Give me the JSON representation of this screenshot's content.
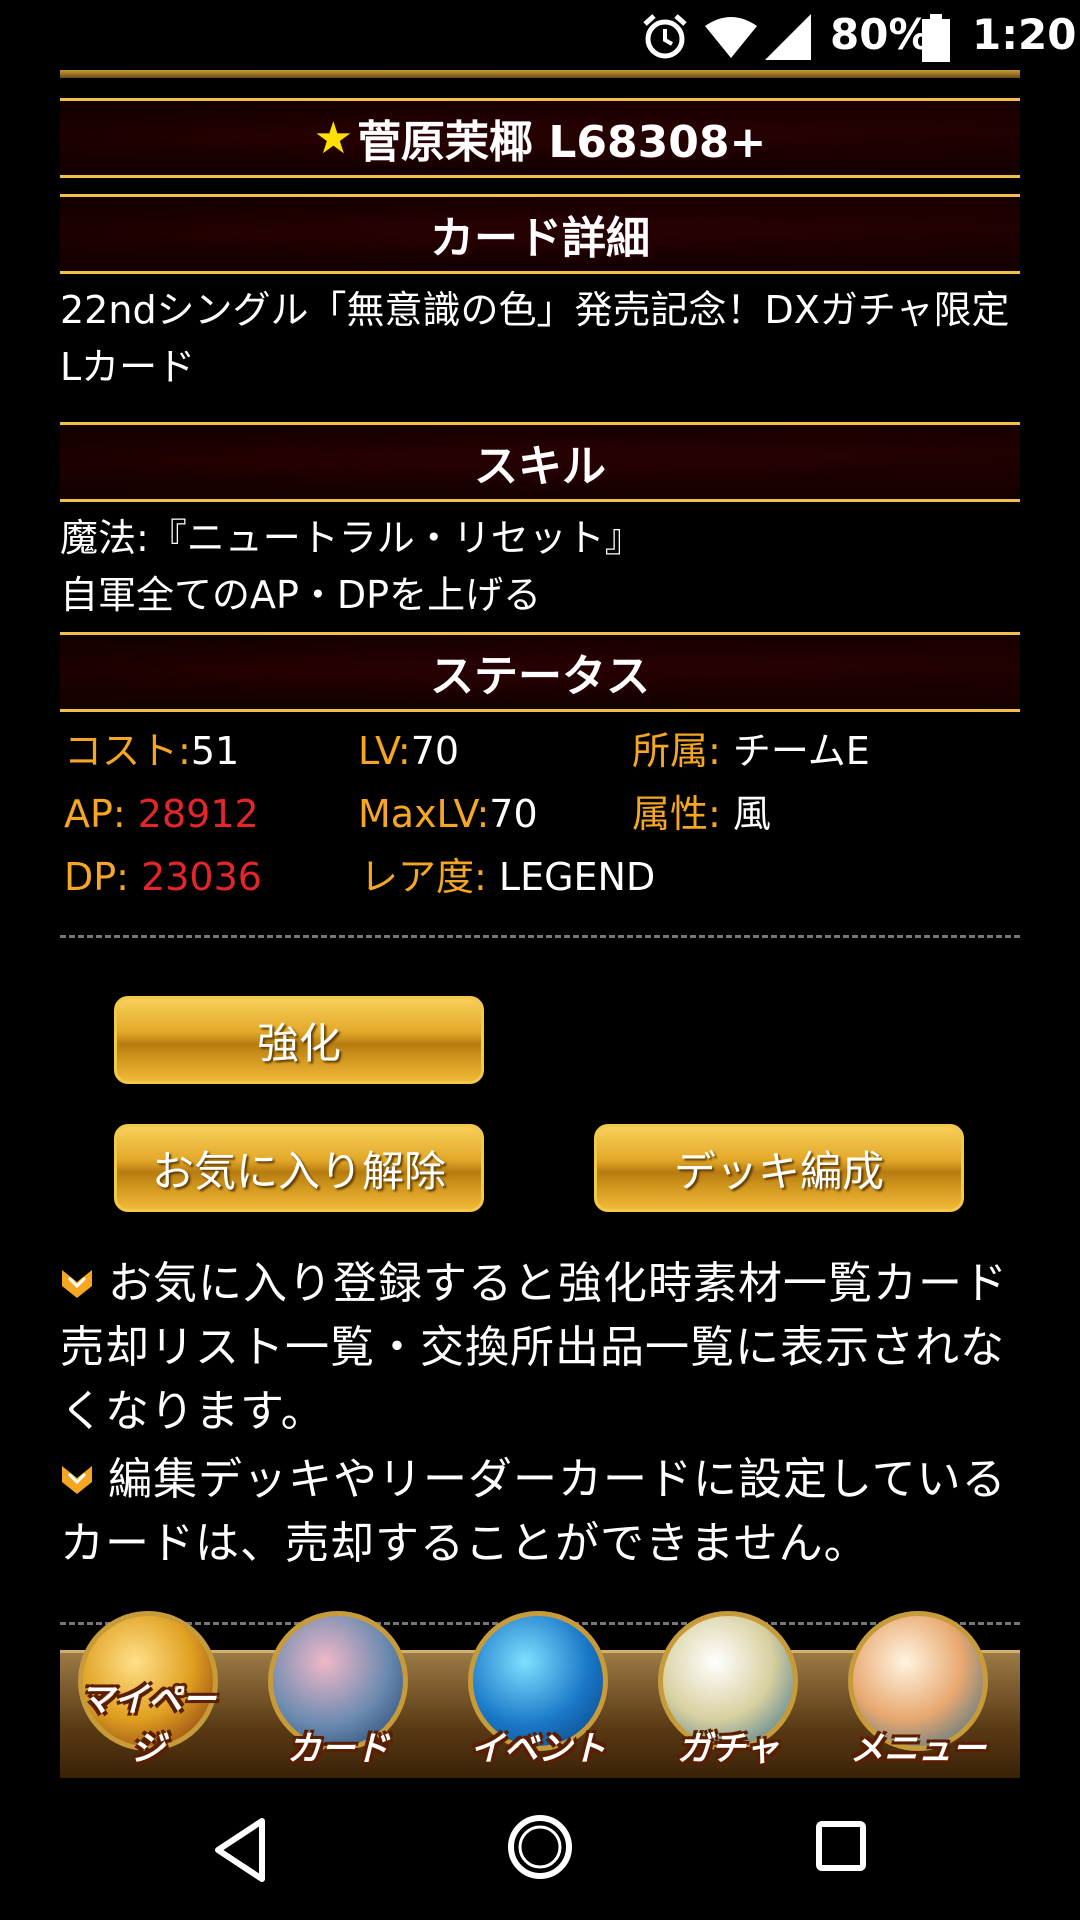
{
  "status_bar": {
    "battery_percent": "80%",
    "time": "1:20",
    "icons": [
      "alarm-icon",
      "wifi-icon",
      "signal-icon",
      "battery-icon"
    ]
  },
  "card": {
    "title_star": "★",
    "title": "菅原茉椰 L68308+"
  },
  "sections": {
    "detail_header": "カード詳細",
    "detail_text": "22ndシングル「無意識の色」発売記念！DXガチャ限定Lカード",
    "skill_header": "スキル",
    "skill_line1": "魔法:『ニュートラル・リセット』",
    "skill_line2": "自軍全てのAP・DPを上げる",
    "status_header": "ステータス"
  },
  "stats": {
    "cost_label": "コスト:",
    "cost_value": "51",
    "lv_label": "LV:",
    "lv_value": "70",
    "affiliation_label": "所属:",
    "affiliation_value": " チームE",
    "ap_label": "AP:",
    "ap_value": " 28912",
    "maxlv_label": "MaxLV:",
    "maxlv_value": "70",
    "attribute_label": "属性:",
    "attribute_value": " 風",
    "dp_label": "DP:",
    "dp_value": " 23036",
    "rarity_label": "レア度:",
    "rarity_value": " LEGEND"
  },
  "buttons": {
    "enhance": "強化",
    "unfavorite": "お気に入り解除",
    "deck": "デッキ編成"
  },
  "notes": [
    "お気に入り登録すると強化時素材一覧カード売却リスト一覧・交換所出品一覧に表示されなくなります。",
    "編集デッキやリーダーカードに設定しているカードは、売却することができません。"
  ],
  "nav": [
    {
      "label": "マイページ",
      "icon": "heart-icon"
    },
    {
      "label": "カード",
      "icon": "cards-icon"
    },
    {
      "label": "イベント",
      "icon": "music-note-icon"
    },
    {
      "label": "ガチャ",
      "icon": "crystal-ball-icon"
    },
    {
      "label": "メニュー",
      "icon": "letter-icon"
    }
  ],
  "colors": {
    "label": "#f5a623",
    "stat_red": "#e4262a",
    "band": "#7a1020",
    "band_border": "#f2c04a",
    "button": "#e3a92a"
  }
}
